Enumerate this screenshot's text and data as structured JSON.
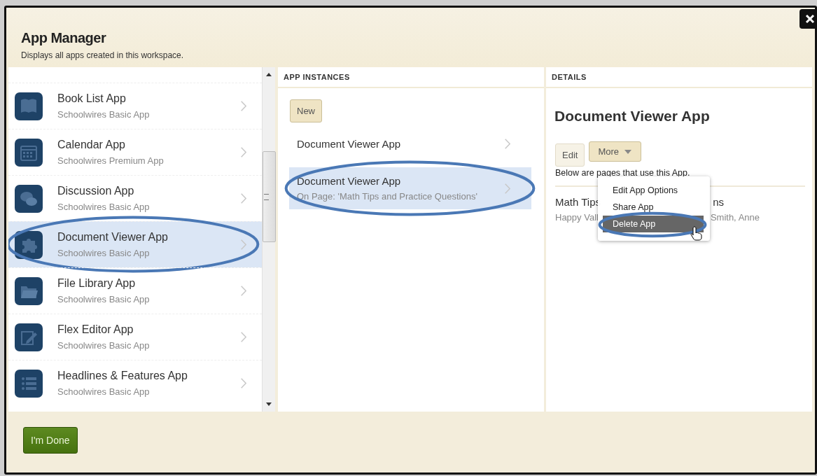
{
  "window": {
    "title": "App Manager",
    "subtitle": "Displays all apps created in this workspace."
  },
  "apps": [
    {
      "name": "Book List App",
      "type": "Schoolwires Basic App",
      "kind": "book",
      "selected": false,
      "circled": false
    },
    {
      "name": "Calendar App",
      "type": "Schoolwires Premium App",
      "kind": "calendar",
      "selected": false,
      "circled": false
    },
    {
      "name": "Discussion App",
      "type": "Schoolwires Basic App",
      "kind": "discussion",
      "selected": false,
      "circled": false
    },
    {
      "name": "Document Viewer App",
      "type": "Schoolwires Basic App",
      "kind": "puzzle",
      "selected": true,
      "circled": true
    },
    {
      "name": "File Library App",
      "type": "Schoolwires Basic App",
      "kind": "folder",
      "selected": false,
      "circled": false
    },
    {
      "name": "Flex Editor App",
      "type": "Schoolwires Basic App",
      "kind": "edit",
      "selected": false,
      "circled": false
    },
    {
      "name": "Headlines & Features App",
      "type": "Schoolwires Basic App",
      "kind": "list",
      "selected": false,
      "circled": false
    }
  ],
  "instances": {
    "header": "APP INSTANCES",
    "new_button": "New",
    "items": [
      {
        "title": "Document Viewer App",
        "selected": false,
        "circled": false
      },
      {
        "title": "Document Viewer App",
        "subtitle": "On Page: 'Math Tips and Practice Questions'",
        "selected": true,
        "circled": true
      }
    ]
  },
  "details": {
    "header": "DETAILS",
    "title": "Document Viewer App",
    "edit_button": "Edit",
    "more_button": "More",
    "caption": "Below are pages that use this App.",
    "pages": [
      {
        "title": "Math Tips",
        "title_end": "ns",
        "authors": "Happy Vall",
        "authors_end": "Smith, Anne"
      }
    ]
  },
  "menu": {
    "items": [
      {
        "label": "Edit App Options",
        "selected": false,
        "circled": false
      },
      {
        "label": "Share App",
        "selected": false,
        "circled": false
      },
      {
        "label": "Delete App",
        "selected": true,
        "circled": true
      }
    ]
  },
  "footer": {
    "done_button": "I'm Done"
  }
}
